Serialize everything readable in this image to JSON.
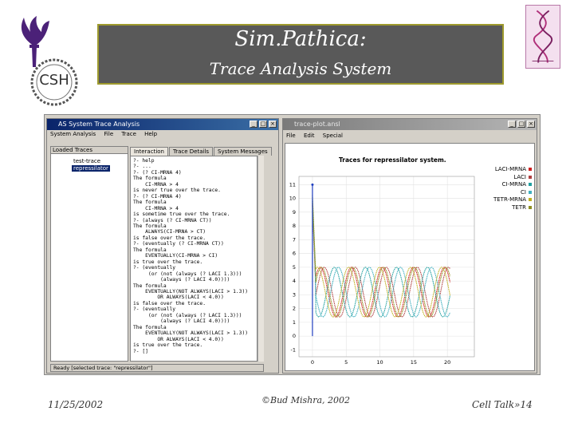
{
  "slide": {
    "title": "Sim.Pathica:",
    "subtitle": "Trace Analysis System",
    "logo_left_text": "CSH",
    "date": "11/25/2002",
    "copyright": "©Bud Mishra, 2002",
    "footer_right": "Cell Talk»14",
    "colors": {
      "banner_bg": "#595959",
      "banner_border": "#9e9a2d",
      "nyu_purple": "#4b2178"
    }
  },
  "trace_window": {
    "title": "AS System Trace Analysis",
    "menu": [
      "System Analysis",
      "File",
      "Trace",
      "Help"
    ],
    "loaded_traces_label": "Loaded Traces",
    "traces": [
      "test-trace",
      "repressilator"
    ],
    "selected_trace": "repressilator",
    "tabs": [
      "Interaction",
      "Trace Details",
      "System Messages"
    ],
    "console_lines": [
      "?- help",
      "?- ...",
      "?- (? CI-MRNA 4)",
      "The formula",
      "    CI-MRNA > 4",
      "is never true over the trace.",
      "?- (? CI-MRNA 4)",
      "The formula",
      "    CI-MRNA > 4",
      "is sometime true over the trace.",
      "?- (always (? CI-MRNA CT))",
      "The formula",
      "    ALWAYS(CI-MRNA > CT)",
      "is false over the trace.",
      "?- (eventually (? CI-MRNA CT))",
      "The formula",
      "    EVENTUALLY(CI-MRNA > CI)",
      "is true over the trace.",
      "?- (eventually",
      "     (or (not (always (? LACI 1.3)))",
      "         (always (? LACI 4.0))))",
      "The formula",
      "    EVENTUALLY(NOT ALWAYS(LACI > 1.3))",
      "        OR ALWAYS(LACI < 4.0))",
      "is false over the trace.",
      "?- (eventually",
      "     (or (not (always (? LACI 1.3)))",
      "         (always (? LACI 4.0))))",
      "The formula",
      "    EVENTUALLY(NOT ALWAYS(LACI > 1.3))",
      "        OR ALWAYS(LACI < 4.0))",
      "is true over the trace.",
      "?- []"
    ],
    "status": "Ready [selected trace: \"repressilator\"]"
  },
  "plot_window": {
    "title": "trace-plot.ansl",
    "menu": [
      "File",
      "Edit",
      "Special"
    ],
    "plot_title": "Traces for repressilator system."
  },
  "chart_data": {
    "type": "line",
    "title": "Traces for repressilator system.",
    "xlabel": "",
    "ylabel": "",
    "x_ticks": [
      0,
      5,
      10,
      15,
      20
    ],
    "y_ticks": [
      -1,
      0,
      1,
      2,
      3,
      4,
      5,
      6,
      7,
      8,
      9,
      10,
      11
    ],
    "xlim": [
      -2,
      24
    ],
    "ylim": [
      -1.5,
      11.6
    ],
    "grid": true,
    "legend_position": "right",
    "series": [
      {
        "name": "LACI-MRNA",
        "color": "#d02020",
        "phase": 0.0
      },
      {
        "name": "LACI",
        "color": "#b04040",
        "phase": 0.6
      },
      {
        "name": "CI-MRNA",
        "color": "#20a0a0",
        "phase": 2.1
      },
      {
        "name": "CI",
        "color": "#40b0c0",
        "phase": 2.7
      },
      {
        "name": "TETR-MRNA",
        "color": "#c0b020",
        "phase": 4.2
      },
      {
        "name": "TETR",
        "color": "#909020",
        "phase": 4.8
      }
    ],
    "period": 4.6,
    "baseline": 3.2,
    "amplitude": 1.8
  }
}
